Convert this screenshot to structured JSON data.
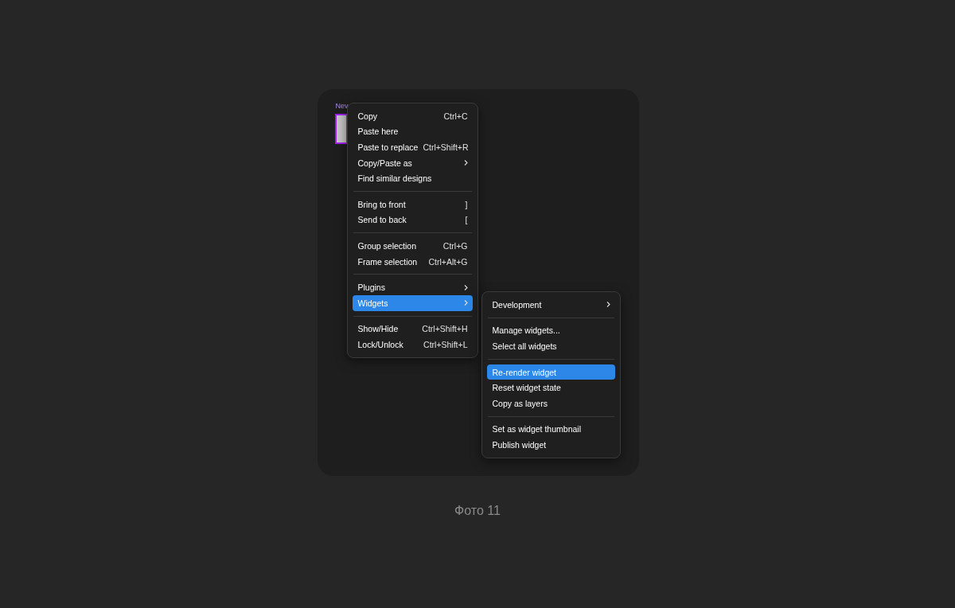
{
  "canvas": {
    "frame_label": "Nev"
  },
  "menu": {
    "groups": [
      [
        {
          "label": "Copy",
          "shortcut": "Ctrl+C",
          "submenu": false,
          "selected": false
        },
        {
          "label": "Paste here",
          "submenu": false,
          "selected": false
        },
        {
          "label": "Paste to replace",
          "shortcut": "Ctrl+Shift+R",
          "submenu": false,
          "selected": false
        },
        {
          "label": "Copy/Paste as",
          "submenu": true,
          "selected": false
        },
        {
          "label": "Find similar designs",
          "submenu": false,
          "selected": false
        }
      ],
      [
        {
          "label": "Bring to front",
          "shortcut": "]",
          "submenu": false,
          "selected": false
        },
        {
          "label": "Send to back",
          "shortcut": "[",
          "submenu": false,
          "selected": false
        }
      ],
      [
        {
          "label": "Group selection",
          "shortcut": "Ctrl+G",
          "submenu": false,
          "selected": false
        },
        {
          "label": "Frame selection",
          "shortcut": "Ctrl+Alt+G",
          "submenu": false,
          "selected": false
        }
      ],
      [
        {
          "label": "Plugins",
          "submenu": true,
          "selected": false
        },
        {
          "label": "Widgets",
          "submenu": true,
          "selected": true
        }
      ],
      [
        {
          "label": "Show/Hide",
          "shortcut": "Ctrl+Shift+H",
          "submenu": false,
          "selected": false
        },
        {
          "label": "Lock/Unlock",
          "shortcut": "Ctrl+Shift+L",
          "submenu": false,
          "selected": false
        }
      ]
    ]
  },
  "submenu": {
    "groups": [
      [
        {
          "label": "Development",
          "submenu": true,
          "selected": false
        }
      ],
      [
        {
          "label": "Manage widgets...",
          "submenu": false,
          "selected": false
        },
        {
          "label": "Select all widgets",
          "submenu": false,
          "selected": false
        }
      ],
      [
        {
          "label": "Re-render widget",
          "submenu": false,
          "selected": true
        },
        {
          "label": "Reset widget state",
          "submenu": false,
          "selected": false
        },
        {
          "label": "Copy as layers",
          "submenu": false,
          "selected": false
        }
      ],
      [
        {
          "label": "Set as widget thumbnail",
          "submenu": false,
          "selected": false
        },
        {
          "label": "Publish widget",
          "submenu": false,
          "selected": false
        }
      ]
    ]
  },
  "caption": "Фото 11"
}
